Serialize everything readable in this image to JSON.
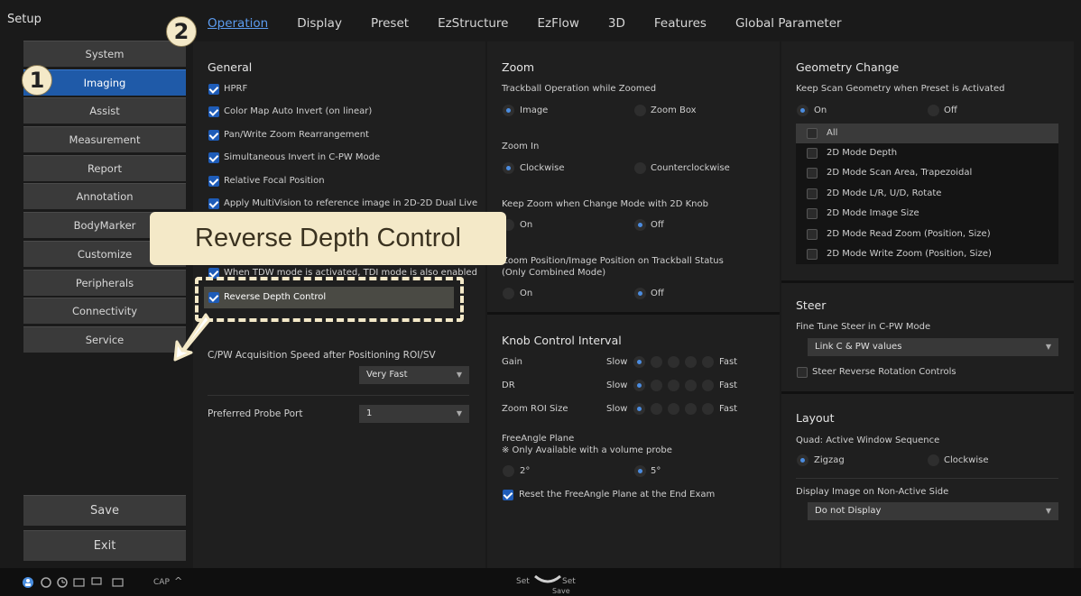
{
  "app": {
    "title": "Setup"
  },
  "sidebar": {
    "items": [
      {
        "label": "System"
      },
      {
        "label": "Imaging"
      },
      {
        "label": "Assist"
      },
      {
        "label": "Measurement"
      },
      {
        "label": "Report"
      },
      {
        "label": "Annotation"
      },
      {
        "label": "BodyMarker"
      },
      {
        "label": "Customize"
      },
      {
        "label": "Peripherals"
      },
      {
        "label": "Connectivity"
      },
      {
        "label": "Service"
      }
    ],
    "active_index": 1,
    "save_label": "Save",
    "exit_label": "Exit"
  },
  "tabs": [
    {
      "label": "Operation"
    },
    {
      "label": "Display"
    },
    {
      "label": "Preset"
    },
    {
      "label": "EzStructure"
    },
    {
      "label": "EzFlow"
    },
    {
      "label": "3D"
    },
    {
      "label": "Features"
    },
    {
      "label": "Global Parameter"
    }
  ],
  "general": {
    "title": "General",
    "options": [
      {
        "label": "HPRF"
      },
      {
        "label": "Color Map Auto Invert (on linear)"
      },
      {
        "label": "Pan/Write Zoom Rearrangement"
      },
      {
        "label": "Simultaneous Invert in C-PW Mode"
      },
      {
        "label": "Relative Focal Position"
      },
      {
        "label": "Apply MultiVision to reference image in 2D-2D Dual Live"
      },
      {
        "label": "When TDW mode is activated, TDI mode is also enabled"
      },
      {
        "label": "Reverse Depth Control"
      }
    ],
    "acq_speed_label": "C/PW Acquisition Speed after Positioning ROI/SV",
    "acq_speed_value": "Very Fast",
    "probe_port_label": "Preferred Probe Port",
    "probe_port_value": "1"
  },
  "zoom": {
    "title": "Zoom",
    "trackball_label": "Trackball Operation while Zoomed",
    "trackball_opt1": "Image",
    "trackball_opt2": "Zoom Box",
    "zoomin_label": "Zoom In",
    "zoomin_opt1": "Clockwise",
    "zoomin_opt2": "Counterclockwise",
    "keep_label": "Keep Zoom when Change Mode with 2D Knob",
    "keep_opt1": "On",
    "keep_opt2": "Off",
    "position_label_1": "Zoom Position/Image Position on Trackball Status",
    "position_label_2": "(Only Combined Mode)",
    "position_opt1": "On",
    "position_opt2": "Off"
  },
  "knob": {
    "title": "Knob Control Interval",
    "rows": [
      {
        "label": "Gain",
        "slow": "Slow",
        "fast": "Fast"
      },
      {
        "label": "DR",
        "slow": "Slow",
        "fast": "Fast"
      },
      {
        "label": "Zoom ROI Size",
        "slow": "Slow",
        "fast": "Fast"
      }
    ],
    "freeangle_label": "FreeAngle Plane",
    "freeangle_note": "※ Only Available with a volume probe",
    "freeangle_opt1": "2°",
    "freeangle_opt2": "5°",
    "reset_label": "Reset the FreeAngle Plane at the End Exam"
  },
  "geometry": {
    "title": "Geometry Change",
    "keep_label": "Keep Scan Geometry when Preset is Activated",
    "opt_on": "On",
    "opt_off": "Off",
    "list": [
      {
        "label": "All"
      },
      {
        "label": "2D Mode Depth"
      },
      {
        "label": "2D Mode Scan Area, Trapezoidal"
      },
      {
        "label": "2D Mode L/R, U/D, Rotate"
      },
      {
        "label": "2D Mode Image Size"
      },
      {
        "label": "2D Mode Read Zoom (Position, Size)"
      },
      {
        "label": "2D Mode Write Zoom (Position, Size)"
      }
    ]
  },
  "steer": {
    "title": "Steer",
    "fine_label": "Fine Tune Steer in C-PW Mode",
    "fine_value": "Link C & PW values",
    "reverse_label": "Steer Reverse Rotation Controls"
  },
  "layout": {
    "title": "Layout",
    "quad_label": "Quad: Active Window Sequence",
    "quad_opt1": "Zigzag",
    "quad_opt2": "Clockwise",
    "display_label": "Display Image on Non-Active Side",
    "display_value": "Do not Display"
  },
  "statusbar": {
    "cap_label": "CAP",
    "set_left": "Set",
    "set_right": "Set",
    "save_label": "Save"
  },
  "callouts": {
    "badge1": "1",
    "badge2": "2",
    "tooltip": "Reverse Depth Control"
  }
}
